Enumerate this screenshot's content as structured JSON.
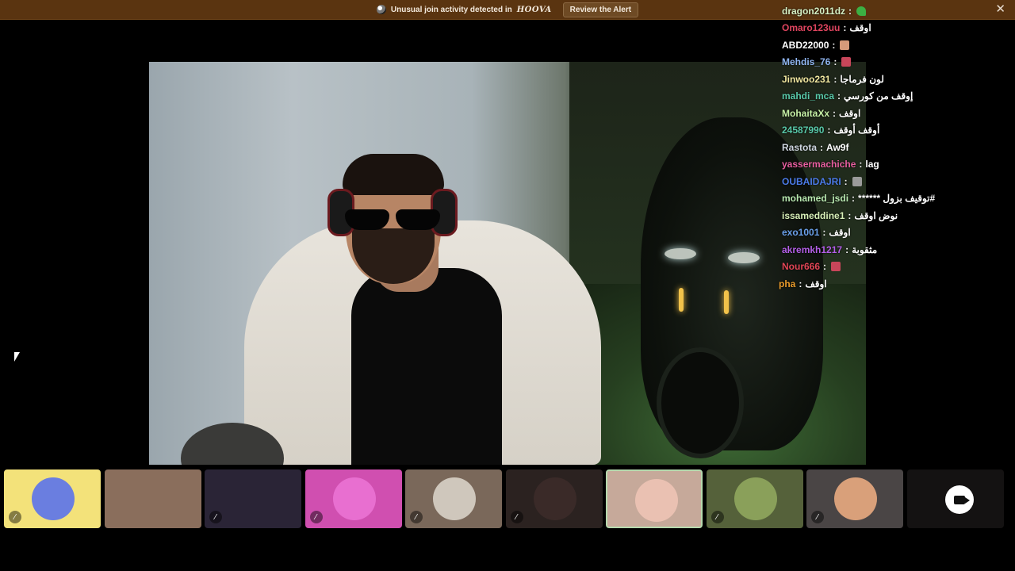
{
  "alert": {
    "text": "Unusual join activity detected in",
    "brand": "HOOVA",
    "button_label": "Review the Alert",
    "close_glyph": "✕"
  },
  "chat": [
    {
      "user": "dragon2011dz",
      "color": "#d6f0c4",
      "message": "",
      "emote": "clover"
    },
    {
      "user": "Omaro123uu",
      "color": "#e0455f",
      "message": "اوقف",
      "emote": ""
    },
    {
      "user": "ABD22000",
      "color": "#ffffff",
      "message": "",
      "emote": "face"
    },
    {
      "user": "Mehdis_76",
      "color": "#8fb5f0",
      "message": "",
      "emote": "red"
    },
    {
      "user": "Jinwoo231",
      "color": "#f1e7a0",
      "message": "لون فرماجا",
      "emote": ""
    },
    {
      "user": "mahdi_mca",
      "color": "#58c7a8",
      "message": "إوقف من كورسي",
      "emote": ""
    },
    {
      "user": "MohaitaXx",
      "color": "#c6f0a6",
      "message": "اوقف",
      "emote": ""
    },
    {
      "user": "24587990",
      "color": "#58c7a8",
      "message": "أوقف أوقف",
      "emote": ""
    },
    {
      "user": "Rastota",
      "color": "#cfd6e0",
      "message": "Aw9f",
      "emote": ""
    },
    {
      "user": "yassermachiche",
      "color": "#e85fa0",
      "message": "lag",
      "emote": ""
    },
    {
      "user": "OUBAIDAJRI",
      "color": "#4b7be8",
      "message": "",
      "emote": "grey"
    },
    {
      "user": "mohamed_jsdi",
      "color": "#b8e8b0",
      "message": "****** توقيف بزول#",
      "emote": ""
    },
    {
      "user": "issameddine1",
      "color": "#d8f0b8",
      "message": "نوض اوقف",
      "emote": ""
    },
    {
      "user": "exo1001",
      "color": "#6aa0ea",
      "message": "اوقف",
      "emote": ""
    },
    {
      "user": "akremkh1217",
      "color": "#b45fe8",
      "message": "مثقوبة",
      "emote": ""
    },
    {
      "user": "Nour666",
      "color": "#e04555",
      "message": "",
      "emote": "red"
    },
    {
      "user": "pha",
      "color": "#e89a2a",
      "message": "اوقف",
      "emote": ""
    }
  ],
  "thumbnails": [
    {
      "name": "thumb-1",
      "bg": "#f3e27a",
      "avatar": "#6a7ee0",
      "mic_off": true,
      "selected": false
    },
    {
      "name": "thumb-2",
      "bg": "#8a6e5c",
      "avatar": "",
      "mic_off": false,
      "selected": false
    },
    {
      "name": "thumb-3",
      "bg": "#2a2436",
      "avatar": "",
      "mic_off": true,
      "selected": false
    },
    {
      "name": "thumb-4",
      "bg": "#d04fb0",
      "avatar": "#e86fd0",
      "mic_off": true,
      "selected": false
    },
    {
      "name": "thumb-5",
      "bg": "#7a685a",
      "avatar": "#cfc7bc",
      "mic_off": true,
      "selected": false
    },
    {
      "name": "thumb-6",
      "bg": "#2b2220",
      "avatar": "#3a2a28",
      "mic_off": true,
      "selected": false
    },
    {
      "name": "thumb-7",
      "bg": "#c6a99a",
      "avatar": "#eac1b2",
      "mic_off": false,
      "selected": true
    },
    {
      "name": "thumb-8",
      "bg": "#55613a",
      "avatar": "#8aa05a",
      "mic_off": true,
      "selected": false
    },
    {
      "name": "thumb-9",
      "bg": "#4a4545",
      "avatar": "#d9a07a",
      "mic_off": true,
      "selected": false
    },
    {
      "name": "thumb-10",
      "bg": "#141212",
      "avatar": "",
      "mic_off": false,
      "selected": false,
      "camera": true
    }
  ],
  "mic_off_glyph": "🎙"
}
